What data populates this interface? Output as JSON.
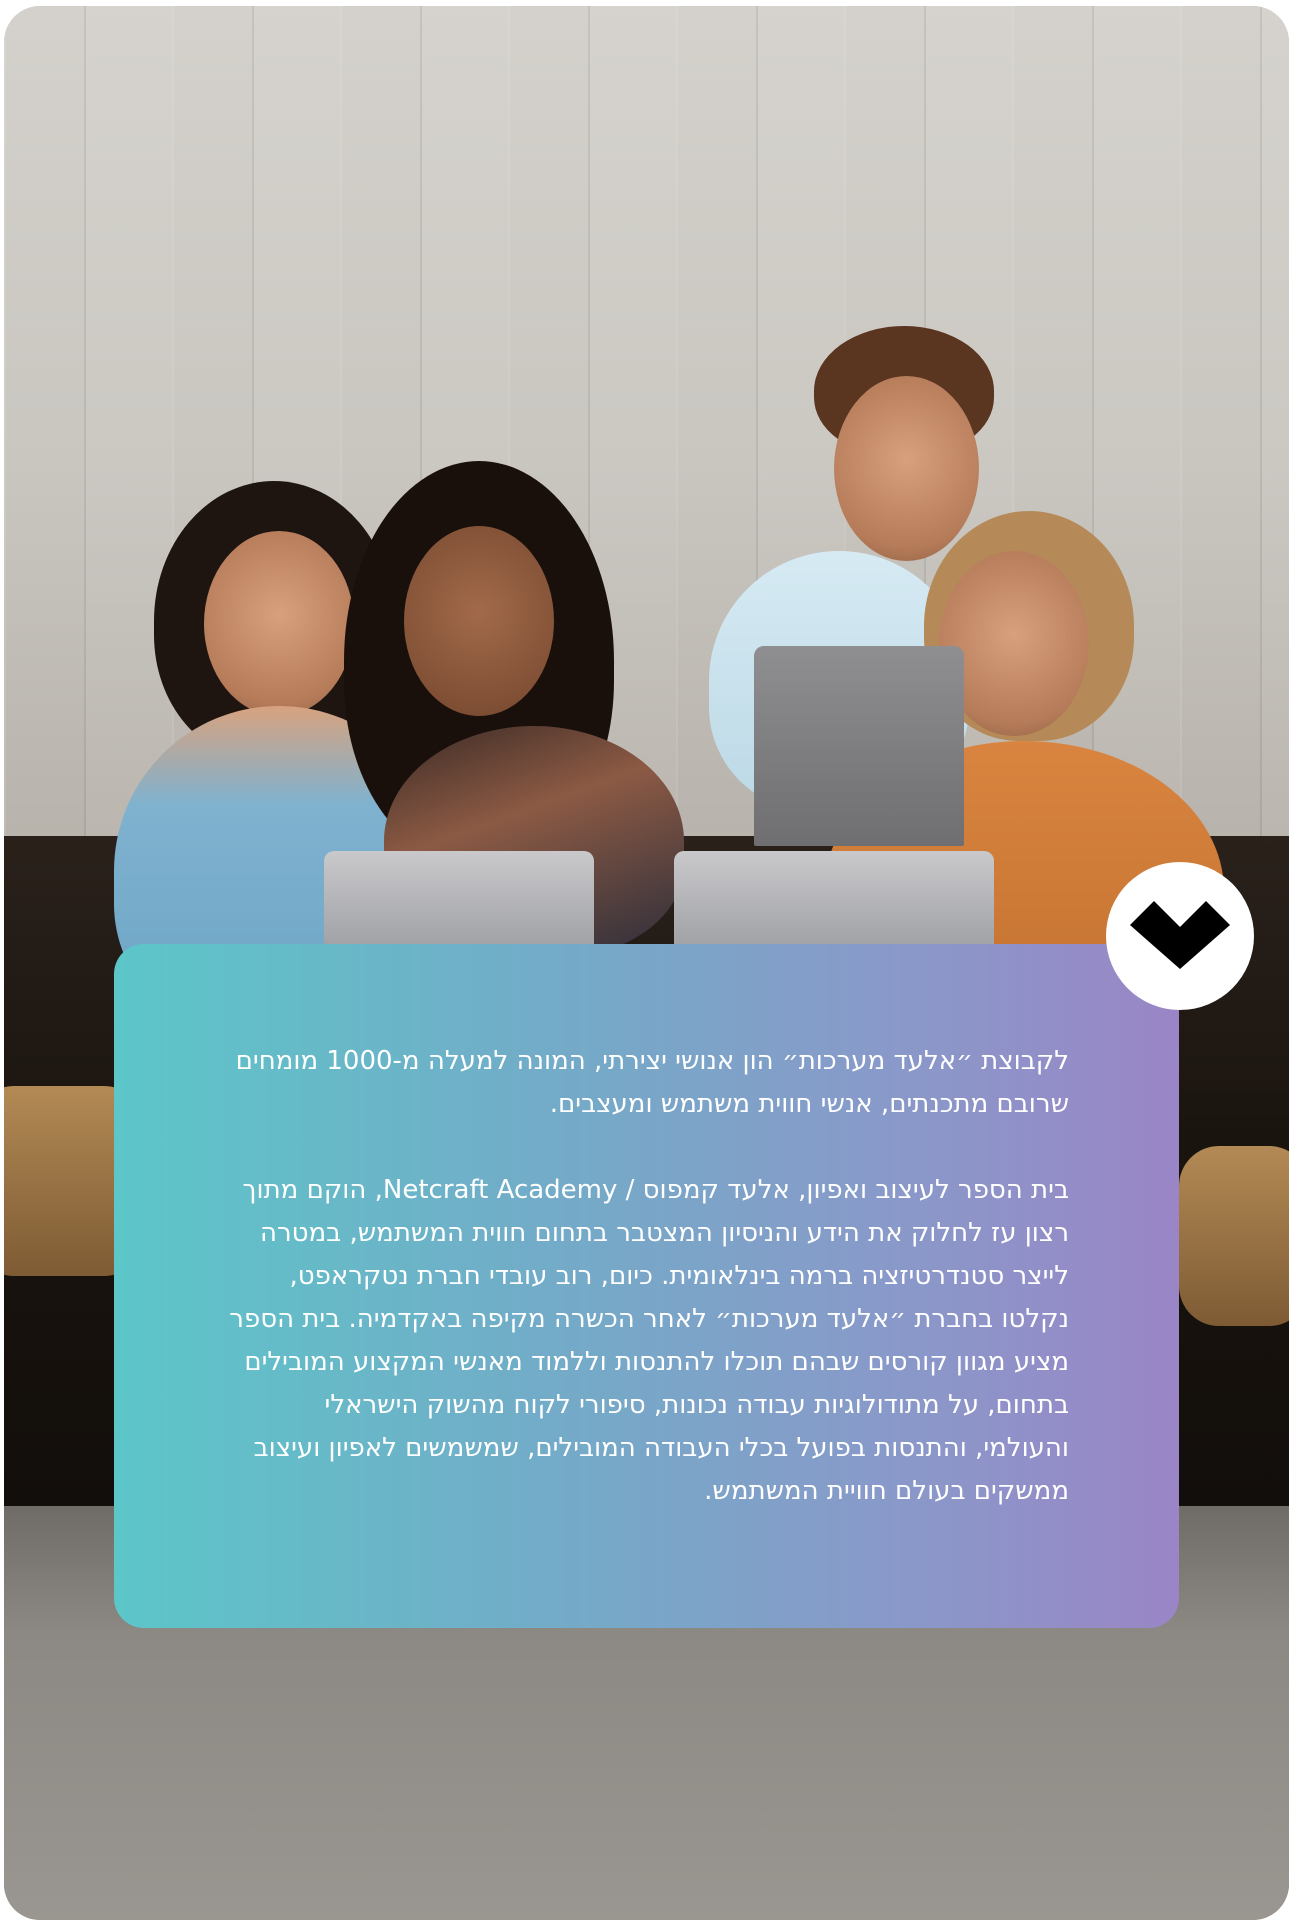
{
  "about": {
    "paragraph_1": "לקבוצת ״אלעד מערכות״ הון אנושי יצירתי, המונה למעלה מ-1000 מומחים שרובם מתכנתים, אנשי חווית משתמש ומעצבים.",
    "paragraph_2": "בית הספר לעיצוב ואפיון, אלעד קמפוס / Netcraft Academy, הוקם מתוך רצון עז לחלוק את הידע והניסיון המצטבר בתחום חווית המשתמש, במטרה לייצר סטנדרטיזציה ברמה בינלאומית. כיום, רוב עובדי חברת נטקראפט, נקלטו בחברת ״אלעד מערכות״ לאחר הכשרה מקיפה באקדמיה. בית הספר מציע מגוון קורסים שבהם תוכלו להתנסות וללמוד מאנשי המקצוע המובילים בתחום, על מתודולוגיות עבודה נכונות, סיפורי לקוח מהשוק הישראלי והעולמי, והתנסות בפועל בכלי העבודה המובילים, שמשמשים לאפיון ועיצוב ממשקים בעולם חוויית המשתמש."
  },
  "controls": {
    "expand_icon": "chevron-down-icon"
  },
  "colors": {
    "panel_gradient_start": "#5cc6c9",
    "panel_gradient_end": "#9a85c6",
    "button_bg": "#ffffff",
    "icon_color": "#000000"
  }
}
